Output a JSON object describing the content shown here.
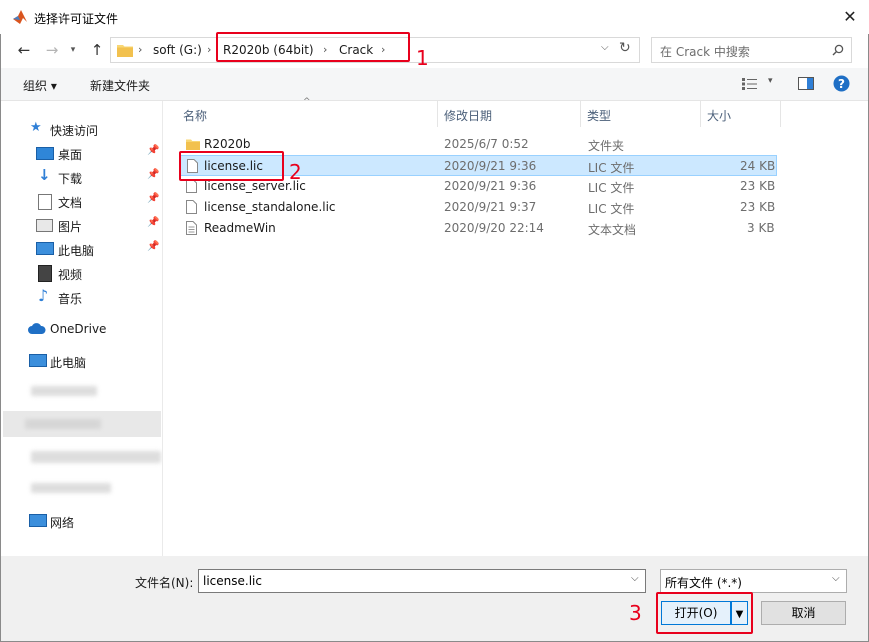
{
  "window": {
    "title": "选择许可证文件"
  },
  "address": {
    "crumbs": [
      "soft (G:)",
      "R2020b  (64bit)",
      "Crack"
    ],
    "search_placeholder": "在 Crack 中搜索"
  },
  "toolbar": {
    "organize": "组织 ▾",
    "new_folder": "新建文件夹"
  },
  "nav": {
    "quick_access": "快速访问",
    "items": [
      "桌面",
      "下载",
      "文档",
      "图片",
      "此电脑",
      "视频",
      "音乐"
    ],
    "onedrive": "OneDrive",
    "this_pc": "此电脑",
    "network": "网络"
  },
  "columns": {
    "name": "名称",
    "date": "修改日期",
    "type": "类型",
    "size": "大小"
  },
  "files": [
    {
      "name": "R2020b",
      "date": "2025/6/7 0:52",
      "type": "文件夹",
      "size": ""
    },
    {
      "name": "license.lic",
      "date": "2020/9/21 9:36",
      "type": "LIC 文件",
      "size": "24 KB"
    },
    {
      "name": "license_server.lic",
      "date": "2020/9/21 9:36",
      "type": "LIC 文件",
      "size": "23 KB"
    },
    {
      "name": "license_standalone.lic",
      "date": "2020/9/21 9:37",
      "type": "LIC 文件",
      "size": "23 KB"
    },
    {
      "name": "ReadmeWin",
      "date": "2020/9/20 22:14",
      "type": "文本文档",
      "size": "3 KB"
    }
  ],
  "bottom": {
    "filename_label": "文件名(N):",
    "filename_value": "license.lic",
    "filetype": "所有文件 (*.*)",
    "open": "打开(O)",
    "cancel": "取消"
  },
  "annotations": {
    "one": "1",
    "two": "2",
    "three": "3"
  },
  "colors": {
    "annotation": "#e8001c",
    "selection": "#cce8ff",
    "accent": "#0078d7"
  }
}
